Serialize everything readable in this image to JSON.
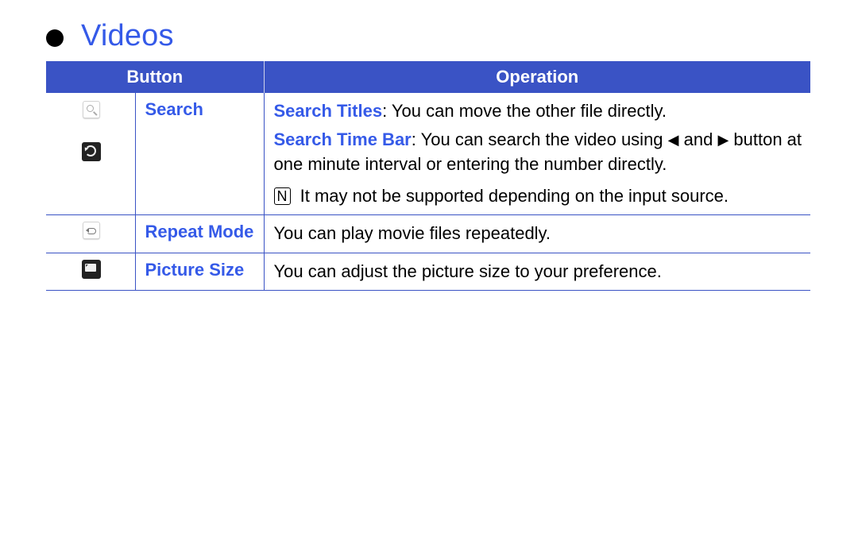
{
  "title": "Videos",
  "headers": {
    "button": "Button",
    "operation": "Operation"
  },
  "rows": {
    "search": {
      "name": "Search",
      "titles_label": "Search Titles",
      "titles_text": ": You can move the other file directly.",
      "timebar_label": "Search Time Bar",
      "timebar_pre": ": You can search the video using ",
      "arrow_left": "◀",
      "timebar_mid": " and ",
      "arrow_right": "▶",
      "timebar_post": " button at one minute interval or entering the number directly.",
      "note_glyph": "N",
      "note_text": "It may not be supported depending on the input source."
    },
    "repeat": {
      "name": "Repeat Mode",
      "op": "You can play movie files repeatedly."
    },
    "psize": {
      "name": "Picture Size",
      "op": "You can adjust the picture size to your preference."
    }
  }
}
